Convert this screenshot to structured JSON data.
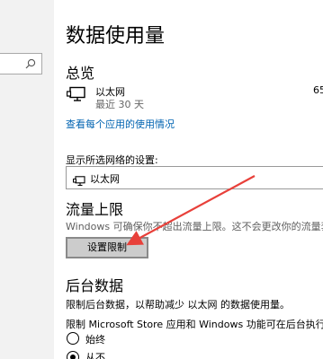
{
  "page": {
    "title": "数据使用量"
  },
  "overview": {
    "heading": "总览",
    "connection_name": "以太网",
    "period": "最近 30 天",
    "usage": "65",
    "per_app_link": "查看每个应用的使用情况"
  },
  "network_setting": {
    "label": "显示所选网络的设置:",
    "selected": "以太网"
  },
  "data_limit": {
    "heading": "流量上限",
    "description": "Windows 可确保你不超出流量上限。这不会更改你的流量套餐。",
    "button_label": "设置限制"
  },
  "background_data": {
    "heading": "后台数据",
    "description": "限制后台数据，以帮助减少 以太网 的数据使用量。",
    "restrict_label": "限制 Microsoft Store 应用和 Windows 功能可在后台执行的操作",
    "options": [
      {
        "label": "始终",
        "selected": false
      },
      {
        "label": "从不",
        "selected": true
      }
    ]
  },
  "annotation": {
    "arrow_color": "#e8403a"
  }
}
